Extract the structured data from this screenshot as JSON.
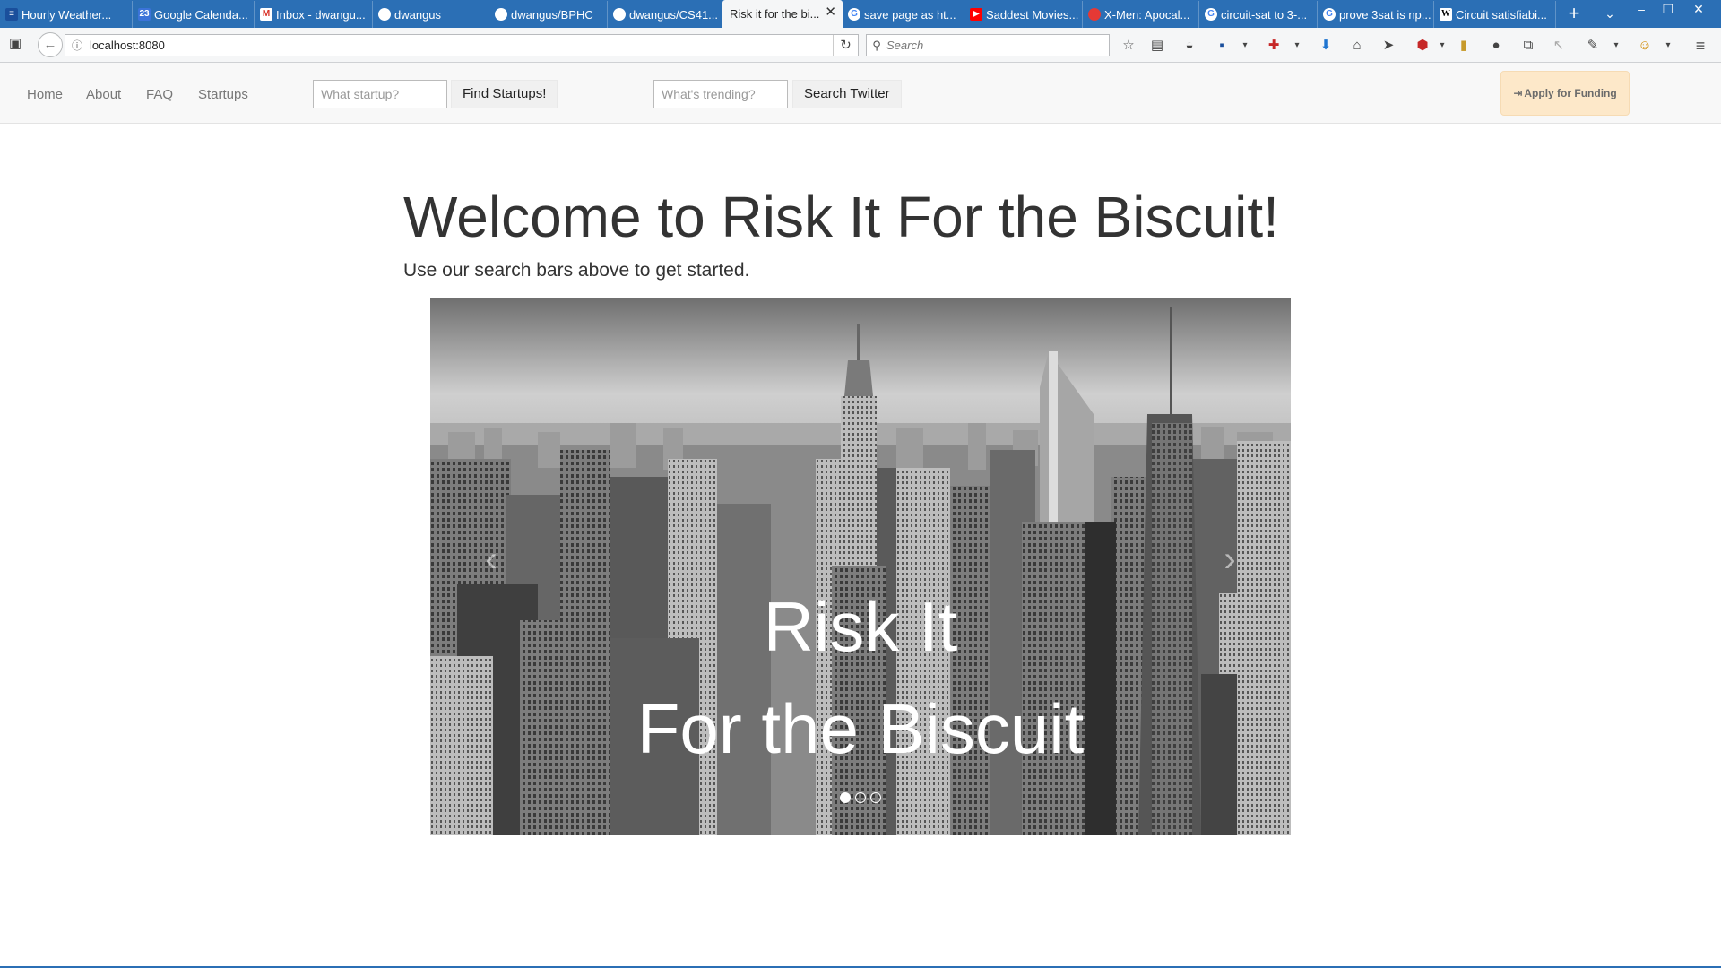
{
  "browser": {
    "tabs": [
      {
        "title": "Hourly Weather...",
        "icon": "weather-icon",
        "color": "#1a4f9c"
      },
      {
        "title": "Google Calenda...",
        "icon": "calendar-icon",
        "color": "#3b73d9"
      },
      {
        "title": "Inbox - dwangu...",
        "icon": "gmail-icon",
        "color": "#d93025"
      },
      {
        "title": "dwangus",
        "icon": "github-icon",
        "color": "#ffffff"
      },
      {
        "title": "dwangus/BPHC",
        "icon": "github-icon",
        "color": "#ffffff"
      },
      {
        "title": "dwangus/CS41...",
        "icon": "github-icon",
        "color": "#ffffff"
      },
      {
        "title": "Risk it for the bi...",
        "icon": "page-icon",
        "color": "#444444"
      },
      {
        "title": "save page as ht...",
        "icon": "google-icon",
        "color": "#4285f4"
      },
      {
        "title": "Saddest Movies...",
        "icon": "youtube-icon",
        "color": "#ff0000"
      },
      {
        "title": "X-Men: Apocal...",
        "icon": "tomato-icon",
        "color": "#e53935"
      },
      {
        "title": "circuit-sat to 3-...",
        "icon": "google-icon",
        "color": "#4285f4"
      },
      {
        "title": "prove 3sat is np...",
        "icon": "google-icon",
        "color": "#4285f4"
      },
      {
        "title": "Circuit satisfiabi...",
        "icon": "wikipedia-icon",
        "color": "#ffffff"
      }
    ],
    "url": "localhost:8080",
    "search_placeholder": "Search",
    "tab_calendar_day": "23",
    "tab_wikipedia_letter": "W"
  },
  "nav": {
    "links": [
      "Home",
      "About",
      "FAQ",
      "Startups"
    ],
    "startup_placeholder": "What startup?",
    "find_button": "Find Startups!",
    "twitter_placeholder": "What's trending?",
    "twitter_button": "Search Twitter",
    "apply_label": "Apply for Funding"
  },
  "hero": {
    "title": "Welcome to Risk It For the Biscuit!",
    "subtitle": "Use our search bars above to get started."
  },
  "carousel": {
    "caption_line1": "Risk It",
    "caption_line2": "For the Biscuit",
    "prev_icon": "chevron-left-icon",
    "next_icon": "chevron-right-icon",
    "slide_count": 3,
    "active_slide": 1
  },
  "colors": {
    "chrome_blue": "#2b6fb5",
    "navbar_bg": "#f8f8f8",
    "apply_bg": "#fde8c9"
  }
}
